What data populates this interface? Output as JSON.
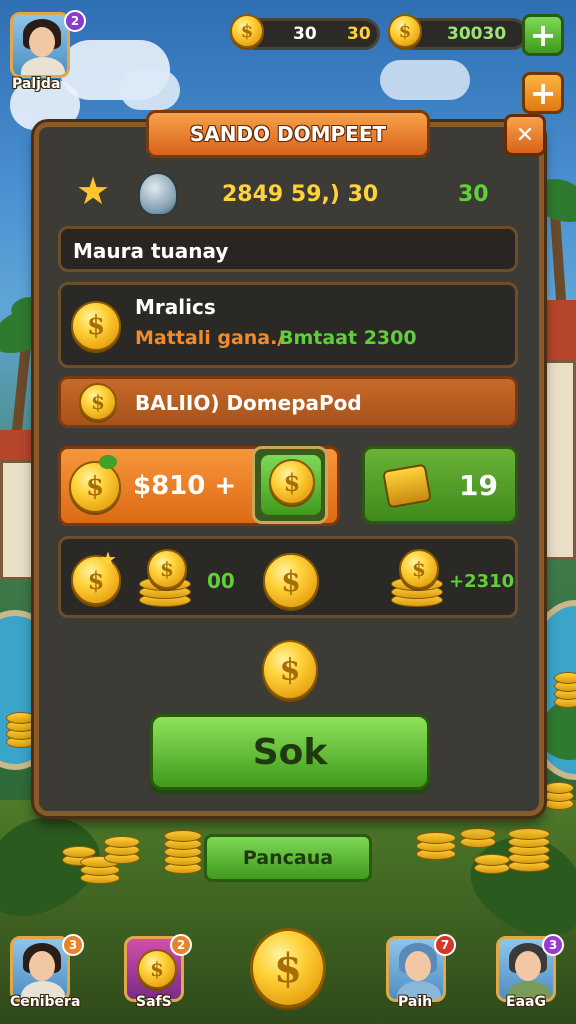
{
  "profile": {
    "name": "Paljda",
    "badge": "2"
  },
  "currency": {
    "bar1": {
      "left": "30",
      "right": "30"
    },
    "bar2": {
      "value": "30030"
    },
    "add_label": "+"
  },
  "dialog": {
    "title": "SANDO DOMPEET",
    "close_label": "✕",
    "stats": {
      "left": "2849 59,) 30",
      "right": "30"
    },
    "name_field": "Maura tuanay",
    "info": {
      "line1": "Mralics",
      "line2a": "Mattali gana./",
      "line2b": "Bmtaat 2300"
    },
    "balance_label": "BALIIO) DomepaPod",
    "offer_left": {
      "value": "$810 +"
    },
    "offer_right": {
      "value": "19"
    },
    "rewards": {
      "a": "00",
      "b": "+2310"
    },
    "ok_label": "Sok"
  },
  "secondary_button": "Pancaua",
  "bottom_bar": [
    {
      "name": "Cenibera",
      "badge": "3",
      "badge_color": "#e9832a"
    },
    {
      "name": "SafS",
      "badge": "2",
      "badge_color": "#e9832a"
    },
    {
      "name": "Paih",
      "badge": "7",
      "badge_color": "#d9342a"
    },
    {
      "name": "EaaG",
      "badge": "3",
      "badge_color": "#9a3ad0"
    }
  ],
  "colors": {
    "orange": "#e9832a",
    "green": "#4fb31c",
    "gold": "#ffd23a",
    "panel": "#3d3b35"
  }
}
